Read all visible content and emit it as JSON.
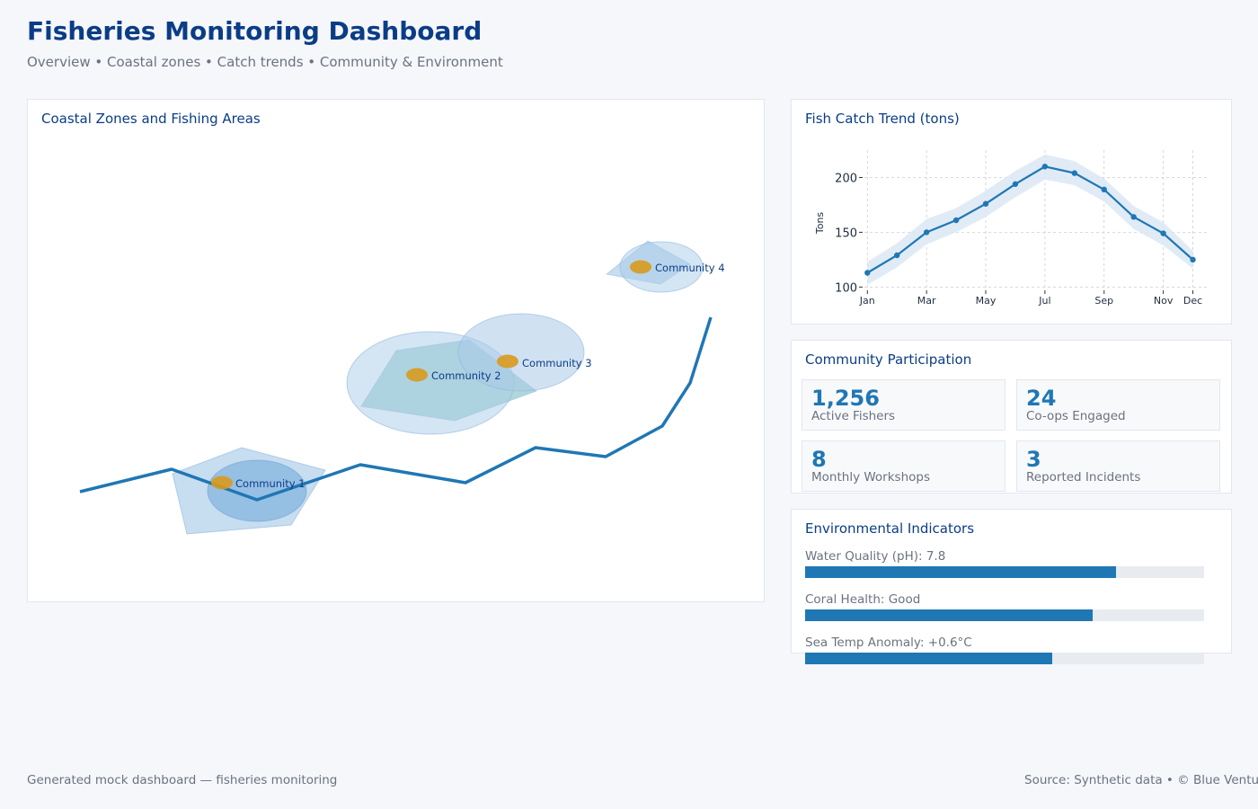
{
  "header": {
    "title": "Fisheries Monitoring Dashboard",
    "subtitle": "Overview • Coastal zones • Catch trends • Community & Environment"
  },
  "map": {
    "title": "Coastal Zones and Fishing Areas",
    "communities": [
      {
        "label": "Community 1"
      },
      {
        "label": "Community 2"
      },
      {
        "label": "Community 3"
      },
      {
        "label": "Community 4"
      }
    ]
  },
  "trend": {
    "title": "Fish Catch Trend (tons)"
  },
  "chart_data": {
    "type": "line",
    "title": "Fish Catch Trend (tons)",
    "ylabel": "Tons",
    "xlabel": "",
    "x": [
      1,
      2,
      3,
      4,
      5,
      6,
      7,
      8,
      9,
      10,
      11,
      12
    ],
    "x_tick_labels": [
      "Jan",
      "Mar",
      "May",
      "Jul",
      "Sep",
      "Nov",
      "Dec"
    ],
    "x_tick_positions": [
      1,
      3,
      5,
      7,
      9,
      11,
      12
    ],
    "series": [
      {
        "values": [
          113,
          129,
          150,
          161,
          176,
          194,
          210,
          204,
          189,
          164,
          149,
          125
        ]
      }
    ],
    "band_upper": [
      123,
      140,
      162,
      172,
      188,
      206,
      221,
      215,
      199,
      174,
      159,
      133
    ],
    "band_lower": [
      102,
      118,
      139,
      150,
      164,
      182,
      198,
      193,
      178,
      153,
      138,
      117
    ],
    "y_ticks": [
      100,
      150,
      200
    ],
    "ylim": [
      97,
      225
    ],
    "xlim": [
      0.9,
      12.5
    ],
    "grid": true
  },
  "community": {
    "title": "Community Participation",
    "stats": [
      {
        "value": "1,256",
        "label": "Active Fishers"
      },
      {
        "value": "24",
        "label": "Co-ops Engaged"
      },
      {
        "value": "8",
        "label": "Monthly Workshops"
      },
      {
        "value": "3",
        "label": "Reported Incidents"
      }
    ]
  },
  "environment": {
    "title": "Environmental Indicators",
    "indicators": [
      {
        "label": "Water Quality (pH): 7.8",
        "level": 0.78
      },
      {
        "label": "Coral Health: Good",
        "level": 0.72
      },
      {
        "label": "Sea Temp Anomaly: +0.6°C",
        "level": 0.62
      }
    ]
  },
  "footer": {
    "left": "Generated mock dashboard — fisheries monitoring",
    "right": "Source: Synthetic data • © Blue Ventures"
  },
  "colors": {
    "accent": "#1f77b4",
    "title": "#0b3d86",
    "zone_fill": "#a9cbe8",
    "community_marker": "#d89a1e",
    "band": "#dbe8f5"
  }
}
